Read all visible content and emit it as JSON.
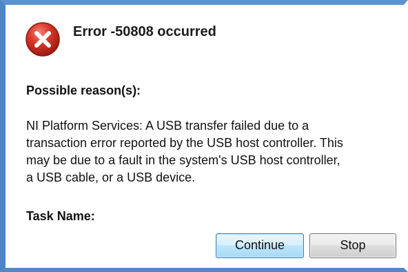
{
  "dialog": {
    "icon": "error-icon",
    "title": "Error -50808 occurred",
    "reason_heading": "Possible reason(s):",
    "message_lines": [
      "NI Platform Services:  A USB transfer failed due to a",
      "transaction error reported by the USB host controller.  This",
      "may be due to a fault in the system's USB host controller,",
      "a USB cable, or a USB device."
    ],
    "task_heading": "Task Name:",
    "buttons": {
      "continue_label": "Continue",
      "stop_label": "Stop"
    }
  },
  "colors": {
    "frame_border": "#4d86c4",
    "error_red": "#cc2b1d",
    "default_button_border": "#3c7fb1"
  }
}
